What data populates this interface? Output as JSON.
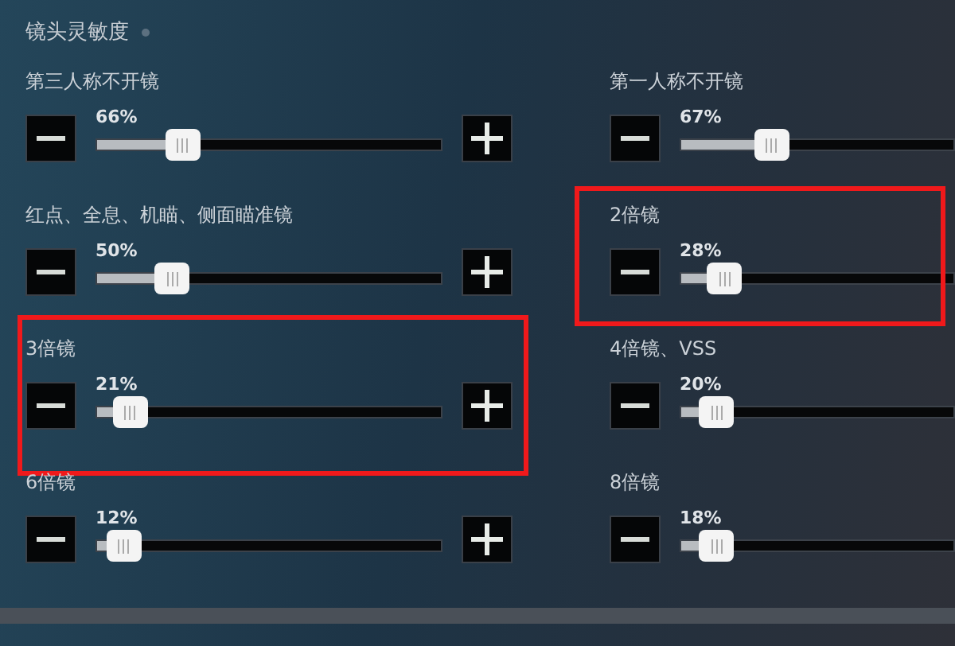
{
  "section_title": "镜头灵敏度",
  "sliders": [
    {
      "label": "第三人称不开镜",
      "reading": "66%",
      "level": 0.2,
      "highlighted": false,
      "has_plus": true
    },
    {
      "label": "第一人称不开镜",
      "reading": "67%",
      "level": 0.27,
      "highlighted": false,
      "has_plus": false
    },
    {
      "label": "红点、全息、机瞄、侧面瞄准镜",
      "reading": "50%",
      "level": 0.17,
      "highlighted": false,
      "has_plus": true
    },
    {
      "label": "2倍镜",
      "reading": "28%",
      "level": 0.1,
      "highlighted": true,
      "has_plus": false
    },
    {
      "label": "3倍镜",
      "reading": "21%",
      "level": 0.05,
      "highlighted": true,
      "has_plus": true
    },
    {
      "label": "4倍镜、VSS",
      "reading": "20%",
      "level": 0.07,
      "highlighted": false,
      "has_plus": false
    },
    {
      "label": "6倍镜",
      "reading": "12%",
      "level": 0.03,
      "highlighted": false,
      "has_plus": true
    },
    {
      "label": "8倍镜",
      "reading": "18%",
      "level": 0.07,
      "highlighted": false,
      "has_plus": false
    }
  ]
}
